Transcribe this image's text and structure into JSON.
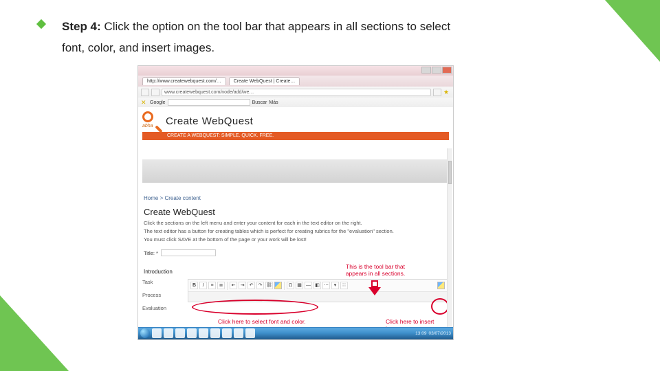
{
  "step": {
    "label": "Step 4:",
    "text_a": "Click the option on the tool bar that appears in all sections to select",
    "text_b": "font, color, and insert images."
  },
  "browser": {
    "tab1": "http://www.createwebquest.com/…",
    "tab2": "Create WebQuest | Create…",
    "url": "www.createwebquest.com/node/add/we…",
    "google_row": {
      "brand": "Google",
      "buscar": "Buscar",
      "mas": "Más"
    }
  },
  "site": {
    "brand": "Create WebQuest",
    "author": "abha",
    "tagline": "CREATE A WEBQUEST: SIMPLE. QUICK. FREE.",
    "breadcrumb": "Home > Create content",
    "h1": "Create WebQuest",
    "p1": "Click the sections on the left menu and enter your content for each in the text editor on the right.",
    "p2": "The text editor has a button for creating tables which is perfect for creating rubrics for the \"evaluation\" section.",
    "p3": "You must click SAVE at the bottom of the page or your work will be lost!",
    "title_label": "Title: *",
    "section_intro": "Introduction",
    "sections": [
      "Task",
      "Process",
      "Evaluation"
    ]
  },
  "callouts": {
    "top": "This is the tool bar that appears in all sections.",
    "bottom_left": "Click here to select font and color.",
    "bottom_right": "Click here to insert images."
  },
  "taskbar": {
    "time": "13:09",
    "date": "03/07/2013"
  }
}
